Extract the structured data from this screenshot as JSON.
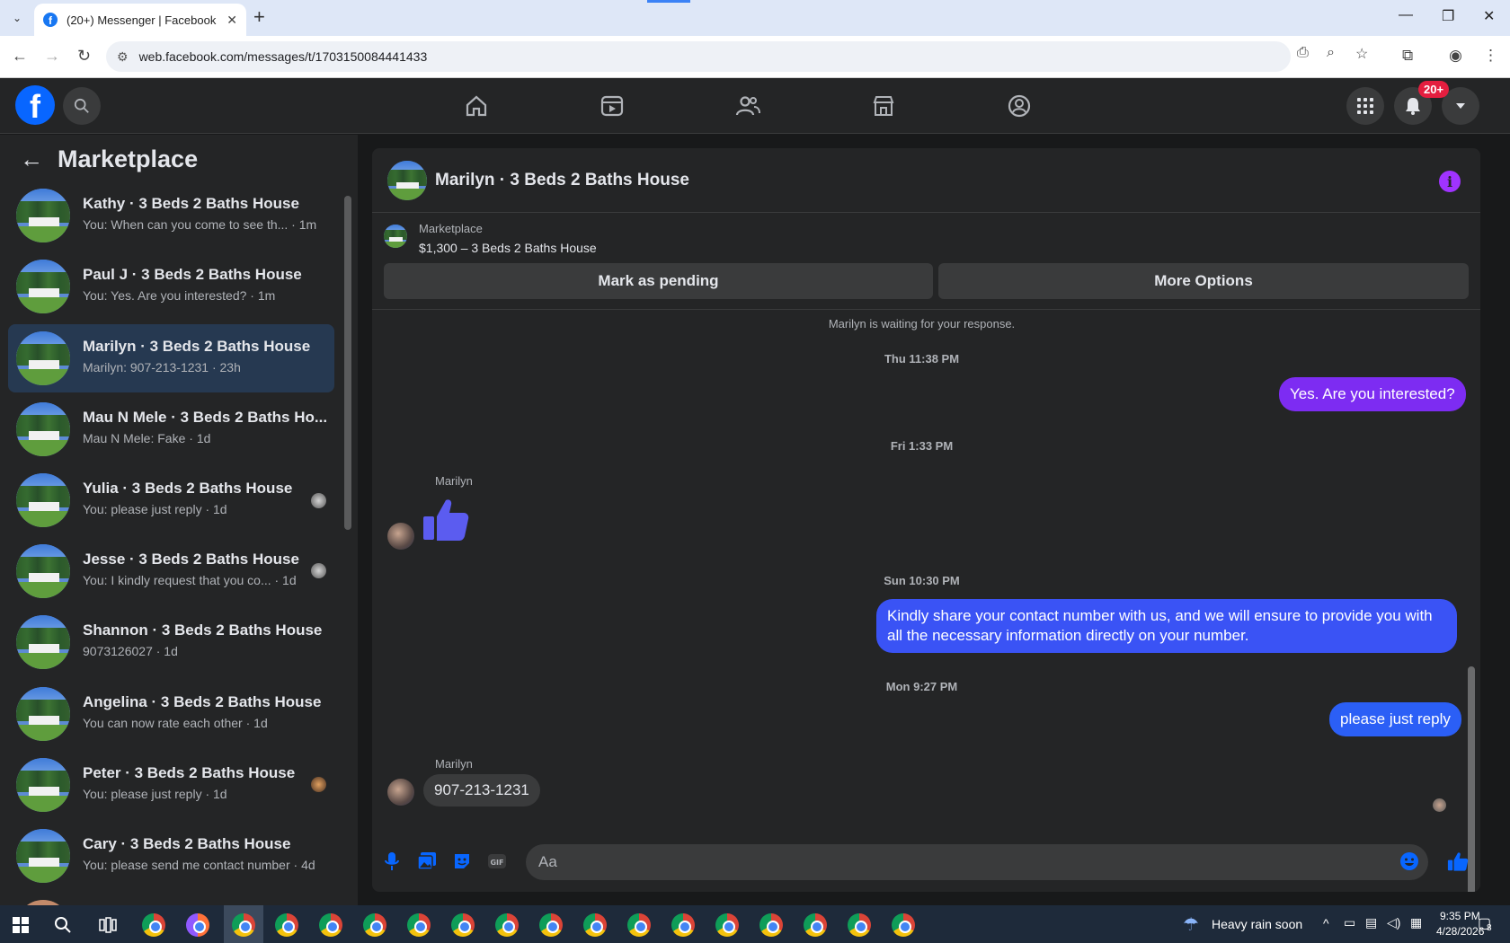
{
  "browser": {
    "tab_title": "(20+) Messenger | Facebook",
    "url": "web.facebook.com/messages/t/1703150084441433"
  },
  "fbnav": {
    "notification_badge": "20+"
  },
  "sidebar": {
    "title": "Marketplace",
    "conversations": [
      {
        "name": "Kathy · 3 Beds 2 Baths House",
        "preview": "You: When can you come to see th... · 1m"
      },
      {
        "name": "Paul J · 3 Beds 2 Baths House",
        "preview": "You: Yes. Are you interested? · 1m"
      },
      {
        "name": "Marilyn · 3 Beds 2 Baths House",
        "preview": "Marilyn: 907-213-1231 · 23h"
      },
      {
        "name": "Mau N Mele · 3 Beds 2 Baths Ho...",
        "preview": "Mau N Mele: Fake · 1d"
      },
      {
        "name": "Yulia · 3 Beds 2 Baths House",
        "preview": "You: please just reply · 1d"
      },
      {
        "name": "Jesse · 3 Beds 2 Baths House",
        "preview": "You: I kindly request that you co... · 1d"
      },
      {
        "name": "Shannon · 3 Beds 2 Baths House",
        "preview": "9073126027 · 1d"
      },
      {
        "name": "Angelina · 3 Beds 2 Baths House",
        "preview": "You can now rate each other · 1d"
      },
      {
        "name": "Peter · 3 Beds 2 Baths House",
        "preview": "You: please just reply · 1d"
      },
      {
        "name": "Cary · 3 Beds 2 Baths House",
        "preview": "You: please send me contact number · 4d"
      }
    ]
  },
  "chat": {
    "title": "Marilyn · 3 Beds 2 Baths House",
    "marketplace_label": "Marketplace",
    "listing": "$1,300 – 3 Beds 2 Baths House",
    "mark_pending": "Mark as pending",
    "more_options": "More Options",
    "waiting": "Marilyn is waiting for your response.",
    "ts1": "Thu 11:38 PM",
    "msg1": "Yes. Are you interested?",
    "ts2": "Fri 1:33 PM",
    "sender": "Marilyn",
    "ts3": "Sun 10:30 PM",
    "msg2": "Kindly share your contact number with us, and we will ensure to provide you with all the necessary information directly on your number.",
    "ts4": "Mon 9:27 PM",
    "msg3": "please just reply",
    "msg4": "907-213-1231",
    "composer_placeholder": "Aa"
  },
  "taskbar": {
    "weather": "Heavy rain soon",
    "time": "9:35 PM",
    "date": "4/28/2026",
    "notif_count": "8"
  },
  "colors": {
    "outgoing_bubble_top": "#7d2cf2",
    "outgoing_bubble_bottom": "#2b5ff6",
    "messenger_blue": "#0866ff"
  }
}
